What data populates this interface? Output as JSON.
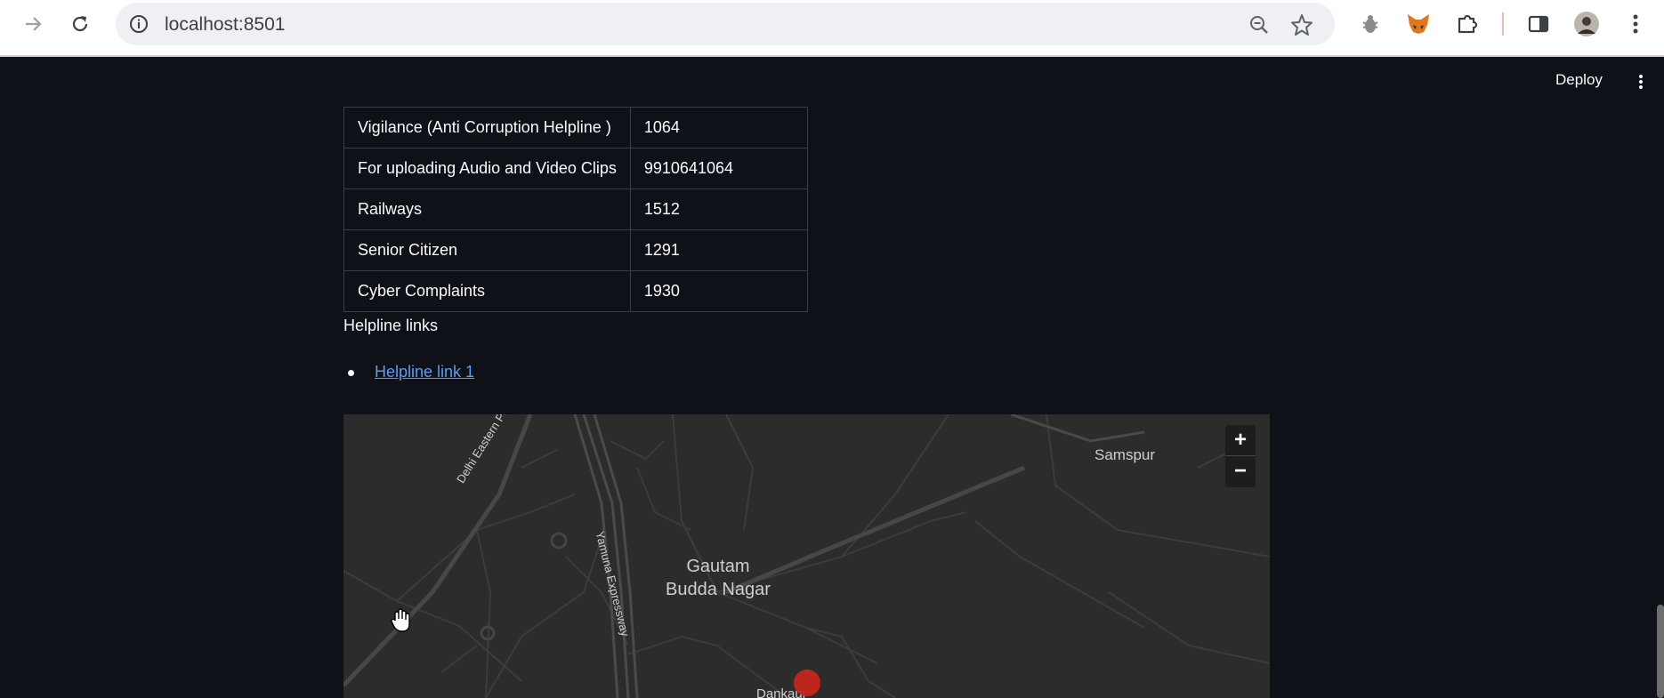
{
  "browser": {
    "url": "localhost:8501",
    "icons": [
      "back-icon",
      "reload-icon",
      "site-info-icon",
      "zoom-icon",
      "bookmark-star-icon",
      "bug-extension-icon",
      "fox-extension-icon",
      "puzzle-extensions-icon",
      "side-panel-icon",
      "profile-avatar",
      "chrome-menu-icon"
    ]
  },
  "app": {
    "deploy_label": "Deploy"
  },
  "helpline_table": {
    "rows": [
      {
        "service": "Vigilance (Anti Corruption Helpline )",
        "number": "1064"
      },
      {
        "service": "For uploading Audio and Video Clips",
        "number": "9910641064"
      },
      {
        "service": "Railways",
        "number": "1512"
      },
      {
        "service": "Senior Citizen",
        "number": "1291"
      },
      {
        "service": "Cyber Complaints",
        "number": "1930"
      }
    ]
  },
  "helpline_links": {
    "heading": "Helpline links",
    "items": [
      {
        "label": "Helpline link 1"
      }
    ]
  },
  "map": {
    "labels": {
      "district_line1": "Gautam",
      "district_line2": "Budda Nagar",
      "samspur": "Samspur",
      "dankaur": "Dankaur",
      "road_expressway": "Delhi Eastern Peripheral Express",
      "road_yamuna": "Yamuna Expressway"
    },
    "zoom_in": "+",
    "zoom_out": "−",
    "marker_color": "#c6251c"
  }
}
